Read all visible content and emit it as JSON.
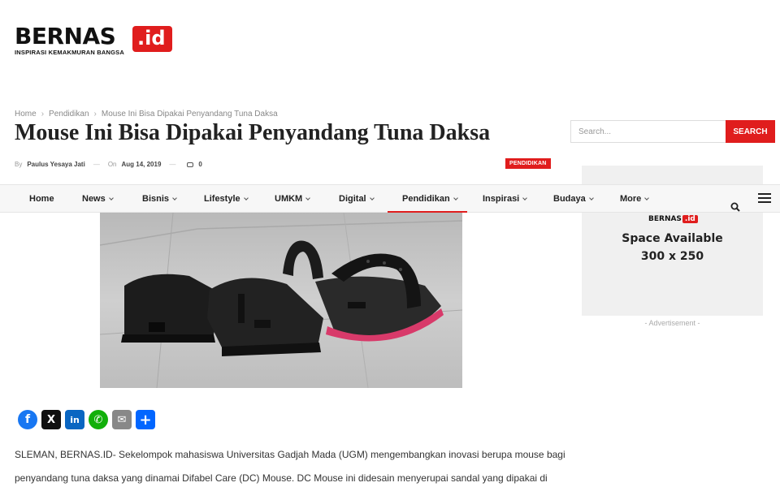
{
  "site": {
    "logo_main": "BERNAS",
    "logo_badge": ".id",
    "logo_tagline": "INSPIRASI KEMAKMURAN BANGSA"
  },
  "breadcrumb": [
    "Home",
    "Pendidikan",
    "Mouse Ini Bisa Dipakai Penyandang Tuna Daksa"
  ],
  "article": {
    "title": "Mouse Ini Bisa Dipakai Penyandang Tuna Daksa",
    "by_label": "By",
    "author": "Paulus Yesaya Jati",
    "on_label": "On",
    "date": "Aug 14, 2019",
    "comments": "0",
    "category": "PENDIDIKAN",
    "body_line1": "SLEMAN, BERNAS.ID- Sekelompok mahasiswa Universitas Gadjah Mada (UGM) mengembangkan inovasi berupa mouse bagi",
    "body_line2": "penyandang tuna daksa yang dinamai Difabel Care (DC) Mouse. DC Mouse ini didesain menyerupai sandal yang dipakai di"
  },
  "search": {
    "placeholder": "Search...",
    "button_label": "SEARCH"
  },
  "nav": {
    "items": [
      {
        "label": "Home"
      },
      {
        "label": "News"
      },
      {
        "label": "Bisnis"
      },
      {
        "label": "Lifestyle"
      },
      {
        "label": "UMKM"
      },
      {
        "label": "Digital"
      },
      {
        "label": "Pendidikan"
      },
      {
        "label": "Inspirasi"
      },
      {
        "label": "Budaya"
      },
      {
        "label": "More"
      }
    ]
  },
  "ad": {
    "logo_main": "BERNAS",
    "logo_badge": ".id",
    "line1": "Space Available",
    "line2": "300 x 250",
    "caption": "- Advertisement -"
  },
  "share": {
    "buttons": [
      {
        "icon": "facebook-icon",
        "glyph": "f",
        "color": "#1877f2"
      },
      {
        "icon": "x-icon",
        "glyph": "X",
        "color": "#111111"
      },
      {
        "icon": "linkedin-icon",
        "glyph": "in",
        "color": "#0a66c2"
      },
      {
        "icon": "whatsapp-icon",
        "glyph": "✆",
        "color": "#12af0a"
      },
      {
        "icon": "email-icon",
        "glyph": "✉",
        "color": "#888888"
      },
      {
        "icon": "share-icon",
        "glyph": "+",
        "color": "#0166ff"
      }
    ]
  },
  "colors": {
    "accent": "#e01d1d",
    "nav_bg": "#f7f7f7",
    "ad_bg": "#f0f0f0"
  }
}
